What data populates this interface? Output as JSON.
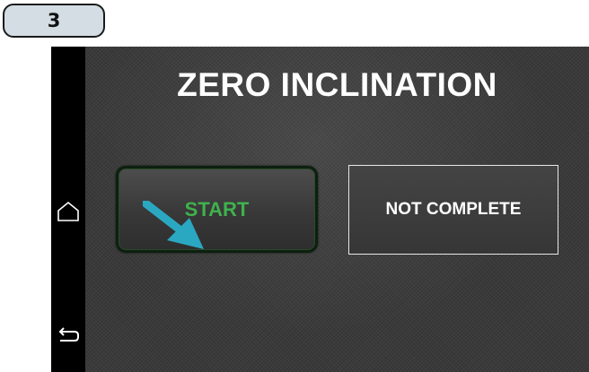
{
  "step_number": "3",
  "screen": {
    "title": "ZERO INCLINATION",
    "start_button_label": "START",
    "status_label": "NOT COMPLETE"
  },
  "nav": {
    "home_icon": "home-icon",
    "back_icon": "back-icon"
  },
  "colors": {
    "start_text": "#3fb24d",
    "arrow": "#2aa8c2",
    "badge_bg": "#d3dde3"
  }
}
